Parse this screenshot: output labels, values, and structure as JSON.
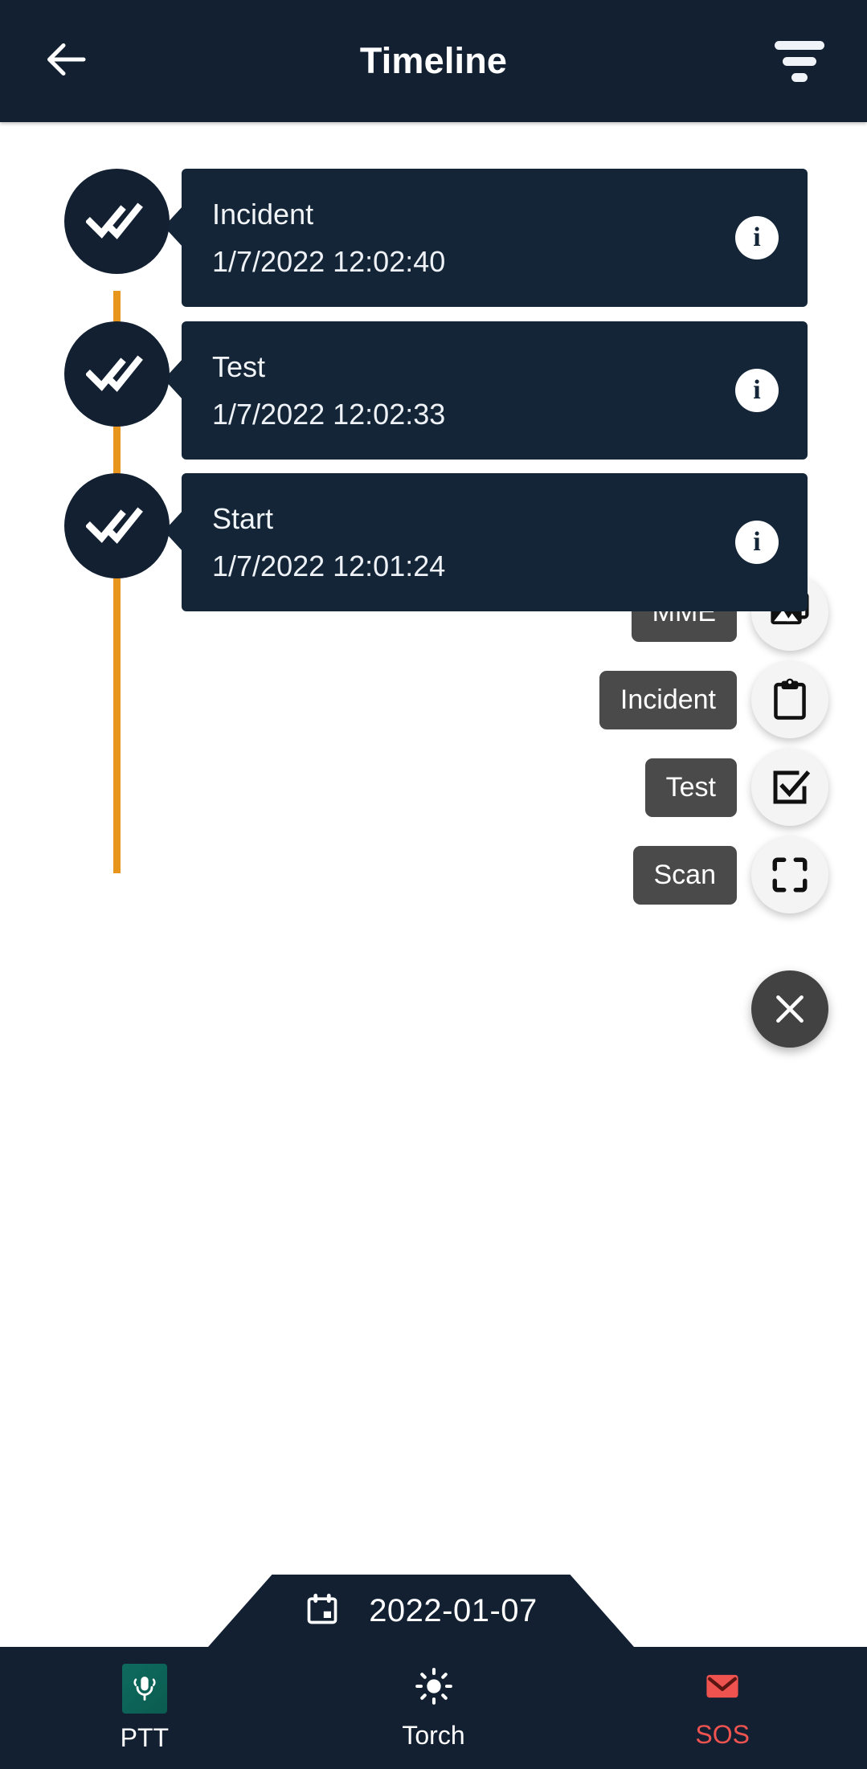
{
  "header": {
    "title": "Timeline",
    "back_icon": "arrow-left-icon",
    "filter_icon": "filter-icon"
  },
  "timeline": {
    "line_color": "#e8951e",
    "marker_icon": "double-check-icon",
    "info_icon_label": "i",
    "events": [
      {
        "title": "Incident",
        "timestamp": "1/7/2022 12:02:40"
      },
      {
        "title": "Test",
        "timestamp": "1/7/2022 12:02:33"
      },
      {
        "title": "Start",
        "timestamp": "1/7/2022 12:01:24"
      }
    ]
  },
  "speed_dial": {
    "open": true,
    "close_icon": "close-icon",
    "items": [
      {
        "label": "MME",
        "icon": "photo-library-icon"
      },
      {
        "label": "Incident",
        "icon": "clipboard-icon"
      },
      {
        "label": "Test",
        "icon": "checkbox-checked-icon"
      },
      {
        "label": "Scan",
        "icon": "scan-frame-icon"
      }
    ]
  },
  "date_bar": {
    "icon": "calendar-icon",
    "date": "2022-01-07"
  },
  "bottom_nav": {
    "items": [
      {
        "label": "PTT",
        "icon": "microphone-icon",
        "color": "#ffffff"
      },
      {
        "label": "Torch",
        "icon": "brightness-icon",
        "color": "#ffffff"
      },
      {
        "label": "SOS",
        "icon": "envelope-icon",
        "color": "#ef5350"
      }
    ]
  },
  "colors": {
    "app_bar": "#122032",
    "card": "#132537",
    "accent_orange": "#e8951e",
    "sos_red": "#ef5350",
    "ptt_teal": "#0e6b5e",
    "dial_label_gray": "#4a4a4a"
  }
}
